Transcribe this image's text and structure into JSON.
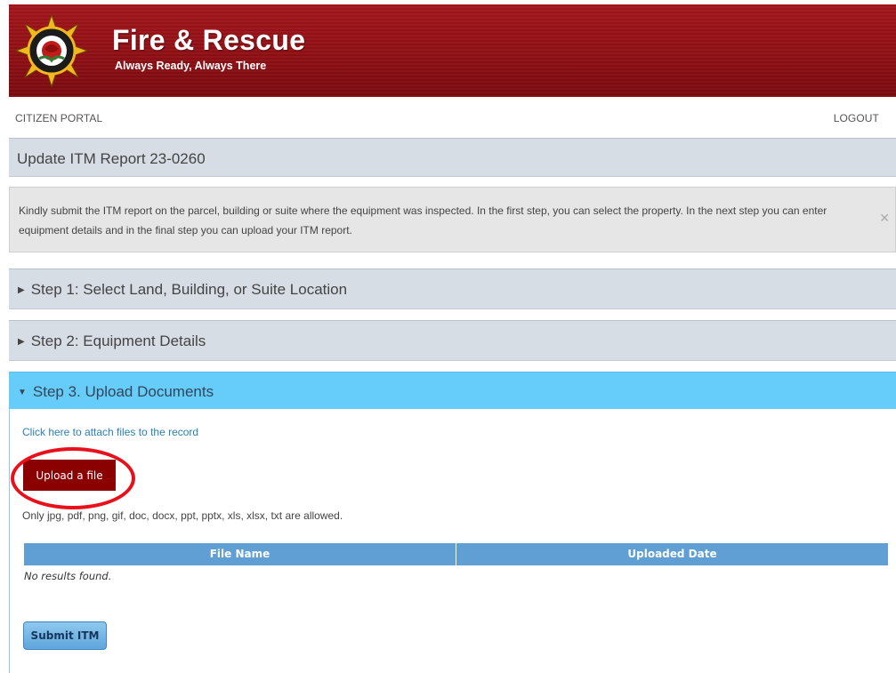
{
  "header": {
    "title": "Fire & Rescue",
    "tagline": "Always Ready, Always There",
    "logo_icon": "fire-rescue-badge-icon",
    "brand_color": "#9b1418"
  },
  "nav": {
    "citizen_portal": "CITIZEN PORTAL",
    "logout": "LOGOUT"
  },
  "page": {
    "title": "Update ITM Report 23-0260"
  },
  "info": {
    "text": "Kindly submit the ITM report on the parcel, building or suite where the equipment was inspected. In the first step, you can select the property. In the next step you can enter equipment details and in the final step you can upload your ITM report.",
    "close_icon": "close-icon"
  },
  "steps": [
    {
      "label": "Step 1: Select Land, Building, or Suite Location",
      "expanded": false
    },
    {
      "label": "Step 2: Equipment Details",
      "expanded": false
    },
    {
      "label": "Step 3. Upload Documents",
      "expanded": true
    }
  ],
  "upload": {
    "attach_link": "Click here to attach files to the record",
    "button_label": "Upload a file",
    "allowed_text": "Only jpg, pdf, png, gif, doc, docx, ppt, pptx, xls, xlsx, txt are allowed.",
    "highlight_color": "#e8101a"
  },
  "files_table": {
    "columns": [
      "File Name",
      "Uploaded Date"
    ],
    "empty_text": "No results found."
  },
  "submit": {
    "label": "Submit ITM"
  },
  "colors": {
    "step_bar": "#d6dde5",
    "active_step": "#66ccf9",
    "upload_button": "#8b0000",
    "table_header": "#5f9fd4"
  }
}
